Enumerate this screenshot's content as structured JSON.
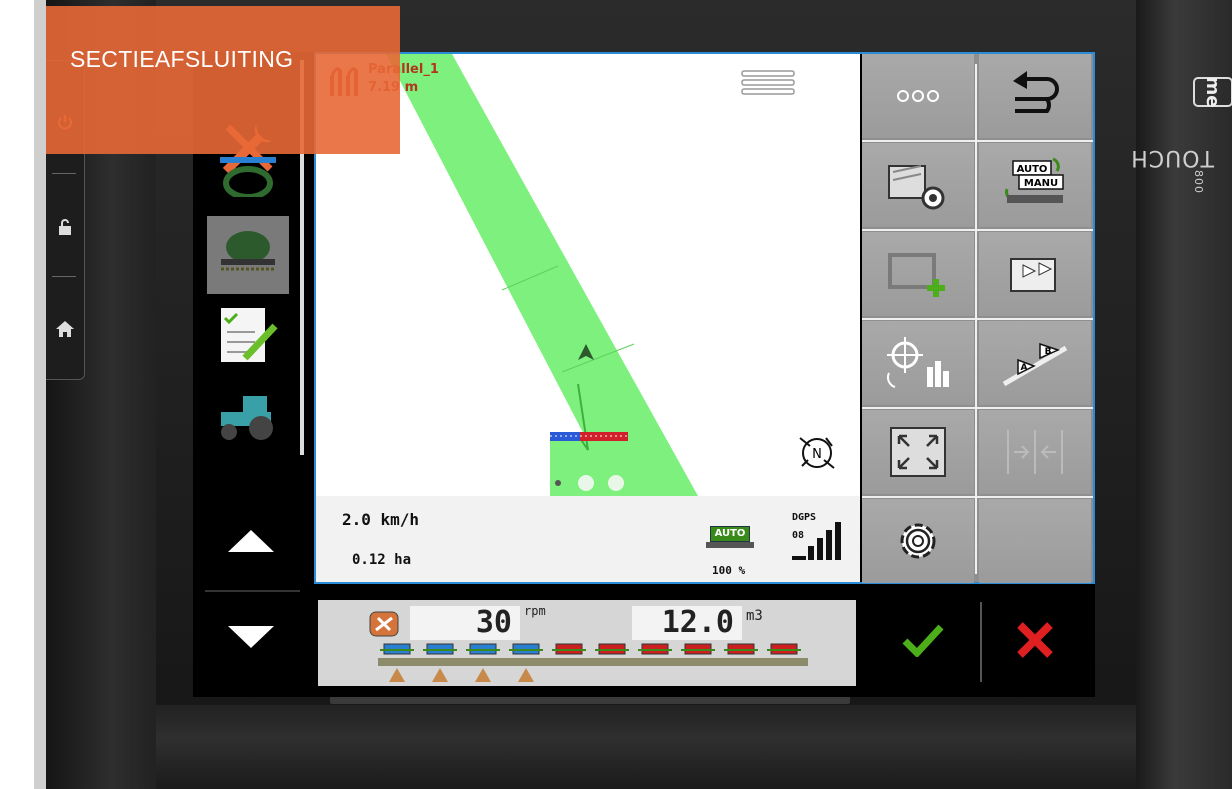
{
  "banner": {
    "title": "SECTIEAFSLUITING"
  },
  "device": {
    "brand_logo": "me",
    "model": "TOUCH",
    "model_number": "800"
  },
  "left_hardkeys": [
    {
      "icon": "power-icon"
    },
    {
      "icon": "unlock-icon"
    },
    {
      "icon": "home-icon"
    }
  ],
  "sidemenu": {
    "items": [
      {
        "icon": "tools-icon"
      },
      {
        "icon": "steering-wheel-icon"
      },
      {
        "icon": "seeder-implement-icon"
      },
      {
        "icon": "task-checklist-icon"
      },
      {
        "icon": "tractor-icon"
      }
    ],
    "up_icon": "arrow-up-icon",
    "down_icon": "arrow-down-icon"
  },
  "map": {
    "guidance_name": "Parallel_1",
    "guidance_width": "7.19 m",
    "compass_label": "N",
    "speed": "2.0 km/h",
    "area": "0.12 ha",
    "auto_label": "AUTO",
    "auto_percent": "100 %",
    "gps_label": "DGPS",
    "gps_satellites": "08"
  },
  "softkeys": [
    {
      "icon": "more-options-icon"
    },
    {
      "icon": "back-icon"
    },
    {
      "icon": "field-settings-icon"
    },
    {
      "icon": "auto-manu-toggle-icon",
      "label_top": "AUTO",
      "label_bottom": "MANU"
    },
    {
      "icon": "add-boundary-icon"
    },
    {
      "icon": "ab-line-flag-icon"
    },
    {
      "icon": "gps-calibrate-icon"
    },
    {
      "icon": "set-ab-line-icon",
      "label_a": "A",
      "label_b": "B"
    },
    {
      "icon": "zoom-extents-icon"
    },
    {
      "icon": "shift-guidance-icon"
    },
    {
      "icon": "settings-gear-icon"
    },
    {
      "icon": ""
    }
  ],
  "implement_bar": {
    "rpm_value": "30",
    "rpm_unit": "rpm",
    "volume_value": "12.0",
    "volume_unit": "m3",
    "sections_active": 4,
    "sections_total": 10
  },
  "actions": {
    "ok_icon": "checkmark-icon",
    "cancel_icon": "close-icon"
  },
  "colors": {
    "banner": "#e86836",
    "coverage": "#7df07d",
    "frame": "#2a8bd6",
    "active_section": "#2a7fd0",
    "inactive_section": "#cc2020"
  }
}
